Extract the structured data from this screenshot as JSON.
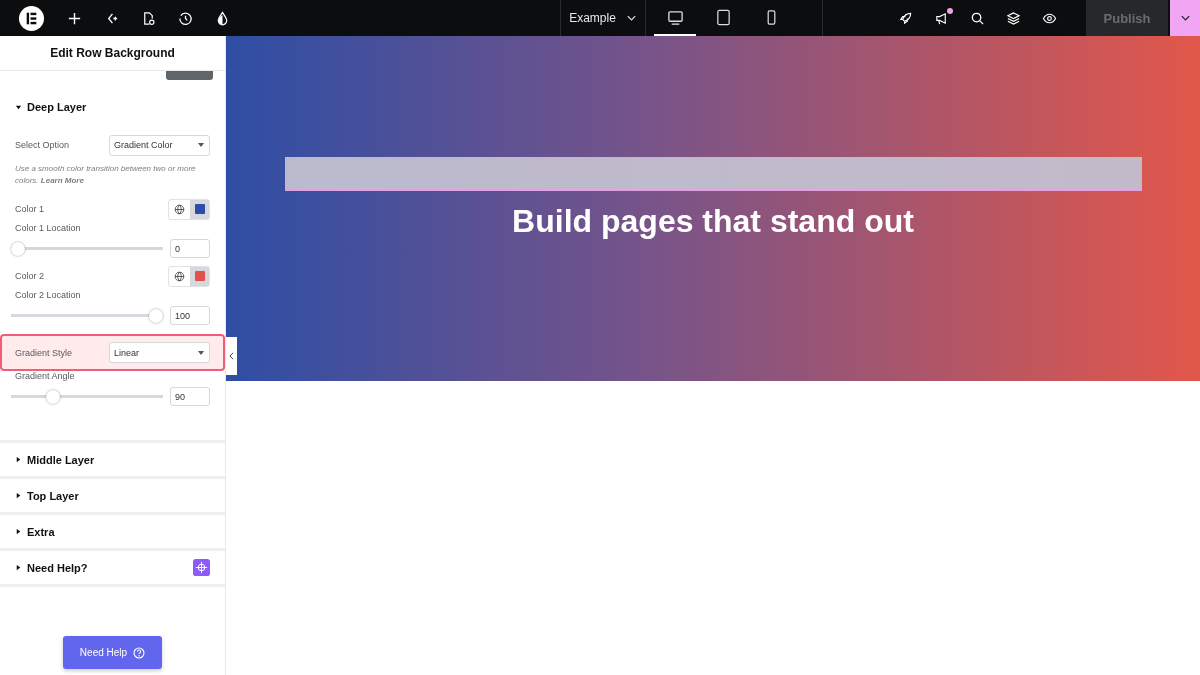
{
  "top_bar": {
    "page_selector": "Example",
    "devices": [
      {
        "kind": "desktop",
        "selected": true
      },
      {
        "kind": "tablet",
        "selected": false
      },
      {
        "kind": "mobile",
        "selected": false
      }
    ],
    "notification_dot": true,
    "publish": "Publish"
  },
  "panel": {
    "title": "Edit Row Background",
    "sections": [
      {
        "title": "Deep Layer",
        "expanded": true,
        "controls": [
          {
            "kind": "select",
            "label": "Select Option",
            "value": "Gradient Color",
            "highlighted": false
          },
          {
            "kind": "note",
            "text": "Use a smooth color transition between two or more colors. **Learn More**"
          },
          {
            "kind": "color",
            "label": "Color 1",
            "color": "#2c4ea6"
          },
          {
            "kind": "slider",
            "label": "Color 1 Location",
            "level": 0,
            "value": "0"
          },
          {
            "kind": "color",
            "label": "Color 2",
            "color": "#e0524a"
          },
          {
            "kind": "slider",
            "label": "Color 2 Location",
            "level": 1,
            "value": "100"
          },
          {
            "kind": "select",
            "label": "Gradient Style",
            "value": "Linear",
            "highlighted": true
          },
          {
            "kind": "slider",
            "label": "Gradient Angle",
            "level": 0.25,
            "value": "90"
          }
        ]
      },
      {
        "title": "Middle Layer",
        "expanded": false
      },
      {
        "title": "Top Layer",
        "expanded": false
      },
      {
        "title": "Extra",
        "expanded": false
      },
      {
        "title": "Need Help?",
        "expanded": false,
        "badge": true
      }
    ],
    "help_button": "Need Help"
  },
  "canvas": {
    "heading": "Build pages that stand out"
  }
}
